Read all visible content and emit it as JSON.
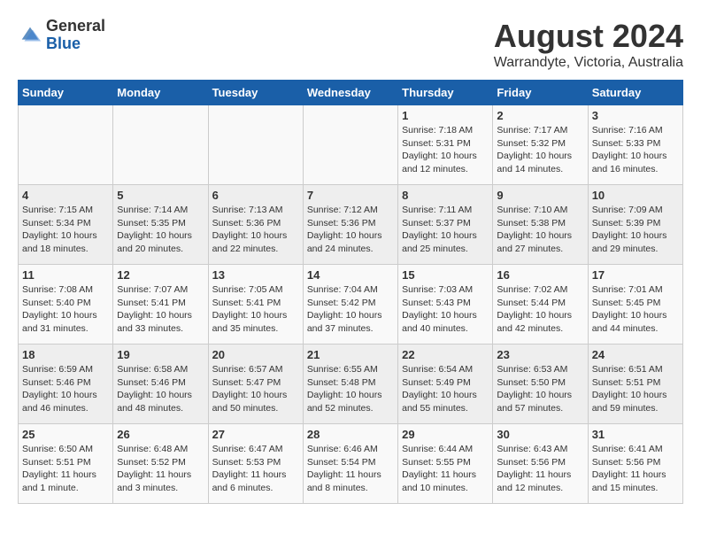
{
  "header": {
    "logo_line1": "General",
    "logo_line2": "Blue",
    "month": "August 2024",
    "location": "Warrandyte, Victoria, Australia"
  },
  "weekdays": [
    "Sunday",
    "Monday",
    "Tuesday",
    "Wednesday",
    "Thursday",
    "Friday",
    "Saturday"
  ],
  "weeks": [
    [
      {
        "day": "",
        "info": ""
      },
      {
        "day": "",
        "info": ""
      },
      {
        "day": "",
        "info": ""
      },
      {
        "day": "",
        "info": ""
      },
      {
        "day": "1",
        "info": "Sunrise: 7:18 AM\nSunset: 5:31 PM\nDaylight: 10 hours\nand 12 minutes."
      },
      {
        "day": "2",
        "info": "Sunrise: 7:17 AM\nSunset: 5:32 PM\nDaylight: 10 hours\nand 14 minutes."
      },
      {
        "day": "3",
        "info": "Sunrise: 7:16 AM\nSunset: 5:33 PM\nDaylight: 10 hours\nand 16 minutes."
      }
    ],
    [
      {
        "day": "4",
        "info": "Sunrise: 7:15 AM\nSunset: 5:34 PM\nDaylight: 10 hours\nand 18 minutes."
      },
      {
        "day": "5",
        "info": "Sunrise: 7:14 AM\nSunset: 5:35 PM\nDaylight: 10 hours\nand 20 minutes."
      },
      {
        "day": "6",
        "info": "Sunrise: 7:13 AM\nSunset: 5:36 PM\nDaylight: 10 hours\nand 22 minutes."
      },
      {
        "day": "7",
        "info": "Sunrise: 7:12 AM\nSunset: 5:36 PM\nDaylight: 10 hours\nand 24 minutes."
      },
      {
        "day": "8",
        "info": "Sunrise: 7:11 AM\nSunset: 5:37 PM\nDaylight: 10 hours\nand 25 minutes."
      },
      {
        "day": "9",
        "info": "Sunrise: 7:10 AM\nSunset: 5:38 PM\nDaylight: 10 hours\nand 27 minutes."
      },
      {
        "day": "10",
        "info": "Sunrise: 7:09 AM\nSunset: 5:39 PM\nDaylight: 10 hours\nand 29 minutes."
      }
    ],
    [
      {
        "day": "11",
        "info": "Sunrise: 7:08 AM\nSunset: 5:40 PM\nDaylight: 10 hours\nand 31 minutes."
      },
      {
        "day": "12",
        "info": "Sunrise: 7:07 AM\nSunset: 5:41 PM\nDaylight: 10 hours\nand 33 minutes."
      },
      {
        "day": "13",
        "info": "Sunrise: 7:05 AM\nSunset: 5:41 PM\nDaylight: 10 hours\nand 35 minutes."
      },
      {
        "day": "14",
        "info": "Sunrise: 7:04 AM\nSunset: 5:42 PM\nDaylight: 10 hours\nand 37 minutes."
      },
      {
        "day": "15",
        "info": "Sunrise: 7:03 AM\nSunset: 5:43 PM\nDaylight: 10 hours\nand 40 minutes."
      },
      {
        "day": "16",
        "info": "Sunrise: 7:02 AM\nSunset: 5:44 PM\nDaylight: 10 hours\nand 42 minutes."
      },
      {
        "day": "17",
        "info": "Sunrise: 7:01 AM\nSunset: 5:45 PM\nDaylight: 10 hours\nand 44 minutes."
      }
    ],
    [
      {
        "day": "18",
        "info": "Sunrise: 6:59 AM\nSunset: 5:46 PM\nDaylight: 10 hours\nand 46 minutes."
      },
      {
        "day": "19",
        "info": "Sunrise: 6:58 AM\nSunset: 5:46 PM\nDaylight: 10 hours\nand 48 minutes."
      },
      {
        "day": "20",
        "info": "Sunrise: 6:57 AM\nSunset: 5:47 PM\nDaylight: 10 hours\nand 50 minutes."
      },
      {
        "day": "21",
        "info": "Sunrise: 6:55 AM\nSunset: 5:48 PM\nDaylight: 10 hours\nand 52 minutes."
      },
      {
        "day": "22",
        "info": "Sunrise: 6:54 AM\nSunset: 5:49 PM\nDaylight: 10 hours\nand 55 minutes."
      },
      {
        "day": "23",
        "info": "Sunrise: 6:53 AM\nSunset: 5:50 PM\nDaylight: 10 hours\nand 57 minutes."
      },
      {
        "day": "24",
        "info": "Sunrise: 6:51 AM\nSunset: 5:51 PM\nDaylight: 10 hours\nand 59 minutes."
      }
    ],
    [
      {
        "day": "25",
        "info": "Sunrise: 6:50 AM\nSunset: 5:51 PM\nDaylight: 11 hours\nand 1 minute."
      },
      {
        "day": "26",
        "info": "Sunrise: 6:48 AM\nSunset: 5:52 PM\nDaylight: 11 hours\nand 3 minutes."
      },
      {
        "day": "27",
        "info": "Sunrise: 6:47 AM\nSunset: 5:53 PM\nDaylight: 11 hours\nand 6 minutes."
      },
      {
        "day": "28",
        "info": "Sunrise: 6:46 AM\nSunset: 5:54 PM\nDaylight: 11 hours\nand 8 minutes."
      },
      {
        "day": "29",
        "info": "Sunrise: 6:44 AM\nSunset: 5:55 PM\nDaylight: 11 hours\nand 10 minutes."
      },
      {
        "day": "30",
        "info": "Sunrise: 6:43 AM\nSunset: 5:56 PM\nDaylight: 11 hours\nand 12 minutes."
      },
      {
        "day": "31",
        "info": "Sunrise: 6:41 AM\nSunset: 5:56 PM\nDaylight: 11 hours\nand 15 minutes."
      }
    ]
  ]
}
